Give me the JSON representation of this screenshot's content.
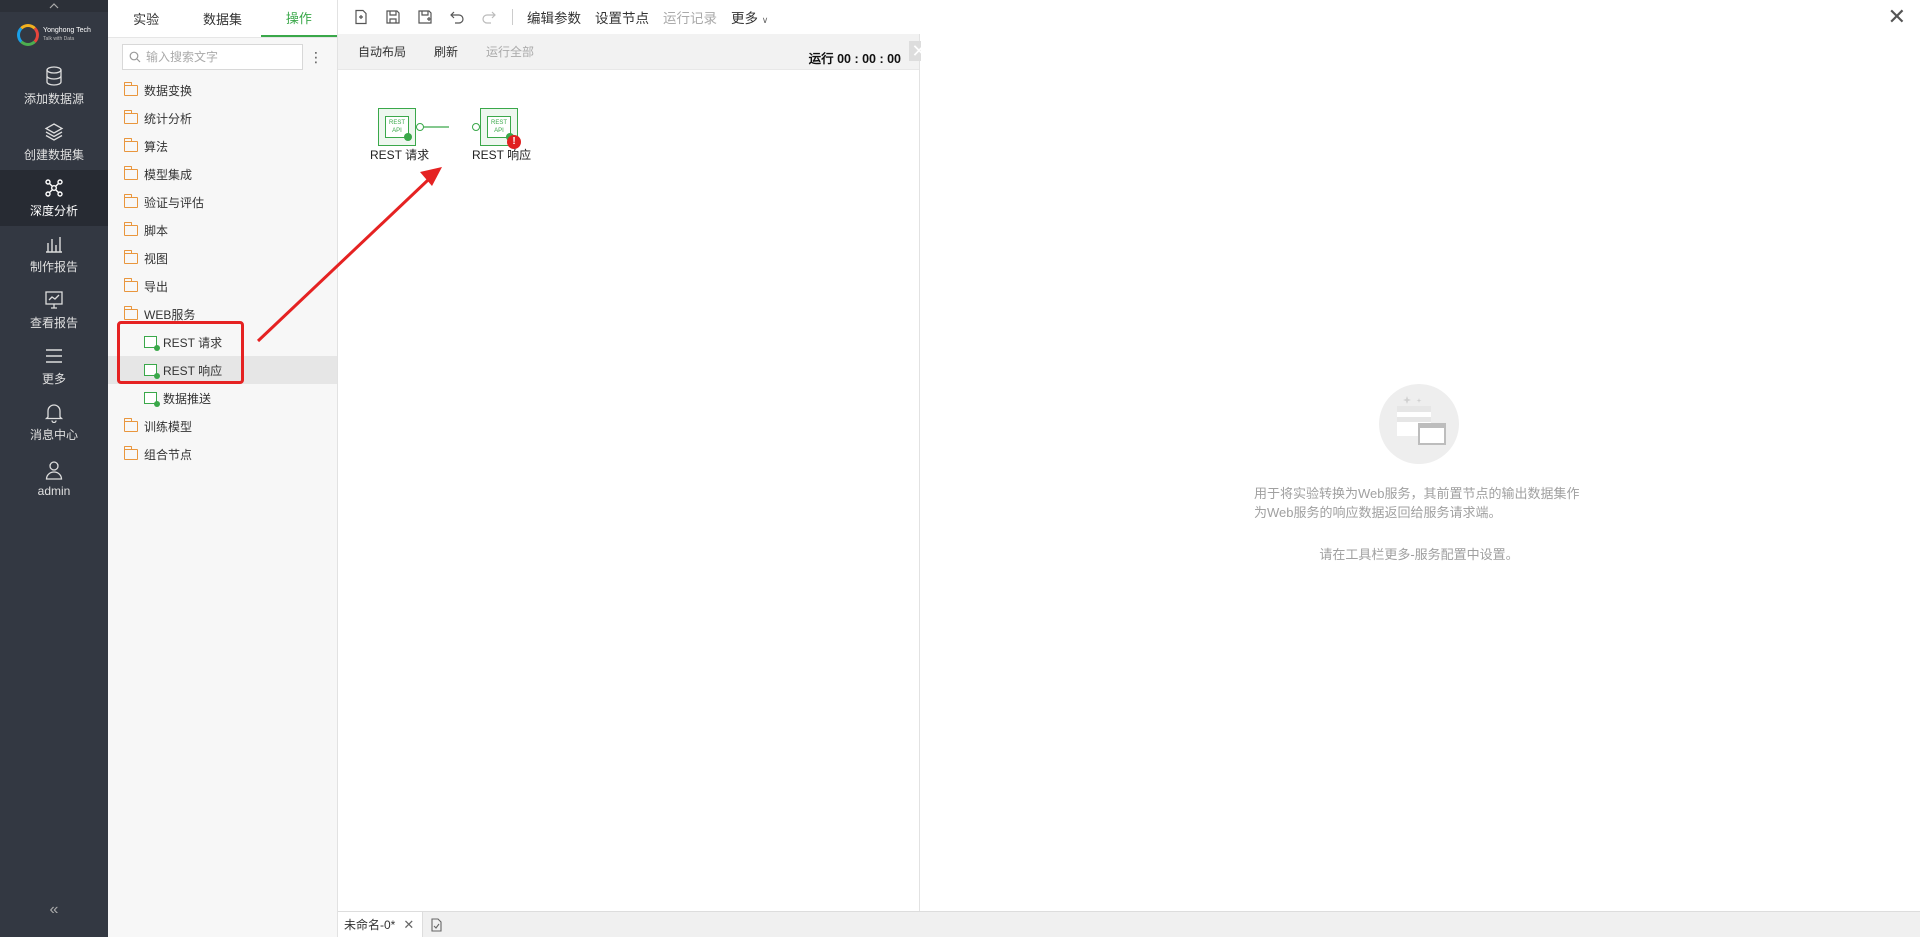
{
  "brand": {
    "name": "Yonghong Tech",
    "tagline": "Talk with Data"
  },
  "left_nav": [
    {
      "key": "add-datasource",
      "label": "添加数据源",
      "icon": "database-icon"
    },
    {
      "key": "create-dataset",
      "label": "创建数据集",
      "icon": "layers-icon"
    },
    {
      "key": "deep-analysis",
      "label": "深度分析",
      "icon": "graph-nodes-icon",
      "active": true
    },
    {
      "key": "make-report",
      "label": "制作报告",
      "icon": "bar-chart-icon"
    },
    {
      "key": "view-report",
      "label": "查看报告",
      "icon": "monitor-chart-icon"
    },
    {
      "key": "more",
      "label": "更多",
      "icon": "menu-icon"
    },
    {
      "key": "message-center",
      "label": "消息中心",
      "icon": "bell-icon"
    },
    {
      "key": "user",
      "label": "admin",
      "icon": "user-icon"
    }
  ],
  "panel": {
    "tabs": [
      "实验",
      "数据集",
      "操作"
    ],
    "active_tab": "操作",
    "search": {
      "placeholder": "输入搜索文字",
      "value": ""
    },
    "tree": [
      {
        "label": "数据变换",
        "type": "folder"
      },
      {
        "label": "统计分析",
        "type": "folder"
      },
      {
        "label": "算法",
        "type": "folder"
      },
      {
        "label": "模型集成",
        "type": "folder"
      },
      {
        "label": "验证与评估",
        "type": "folder"
      },
      {
        "label": "脚本",
        "type": "folder"
      },
      {
        "label": "视图",
        "type": "folder"
      },
      {
        "label": "导出",
        "type": "folder"
      },
      {
        "label": "WEB服务",
        "type": "folder"
      },
      {
        "label": "REST 请求",
        "type": "node"
      },
      {
        "label": "REST 响应",
        "type": "node"
      },
      {
        "label": "数据推送",
        "type": "node"
      },
      {
        "label": "训练模型",
        "type": "folder"
      },
      {
        "label": "组合节点",
        "type": "folder"
      }
    ]
  },
  "toolbar": {
    "edit_params": "编辑参数",
    "set_node": "设置节点",
    "run_log": "运行记录",
    "more": "更多"
  },
  "canvas": {
    "auto_layout": "自动布局",
    "refresh": "刷新",
    "run_all": "运行全部",
    "run_timer": "运行 00 : 00 : 00",
    "nodes": [
      {
        "label": "REST 请求",
        "icon_text": "REST API"
      },
      {
        "label": "REST 响应",
        "icon_text": "REST API",
        "error": "!"
      }
    ]
  },
  "info": {
    "description": "用于将实验转换为Web服务，其前置节点的输出数据集作为Web服务的响应数据返回给服务请求端。",
    "hint": "请在工具栏更多-服务配置中设置。"
  },
  "bottom": {
    "doc_tab": "未命名-0*"
  },
  "colors": {
    "accent": "#3aa84a",
    "nav_bg": "#333842",
    "annotation": "#e52222",
    "folder": "#e9963d"
  }
}
